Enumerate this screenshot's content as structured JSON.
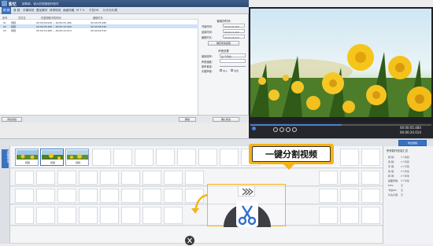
{
  "app": {
    "name": "影忆",
    "subtitle": "超简单、强大的视频制作软件"
  },
  "menu": [
    "视 频",
    "音 频",
    "字幕特效",
    "叠加素材",
    "转场特效",
    "画面风格",
    "M T V",
    "卡拉OK",
    "片头与片尾"
  ],
  "active_menu": "视 频",
  "table": {
    "headers": [
      "序号",
      "文件名",
      "在源视频中的时间",
      "截取时长"
    ],
    "rows": [
      {
        "idx": "01",
        "name": "视频",
        "range": "00:00:00.000 ~ 00:00:05.480",
        "dur": "00:00:05.480"
      },
      {
        "idx": "02",
        "name": "视频",
        "range": "00:00:05.480 ~ 00:00:12.000",
        "dur": "00:00:06.520"
      },
      {
        "idx": "03",
        "name": "视频",
        "range": "00:00:19.480 ~ 00:00:24.014",
        "dur": "00:00:04.534"
      }
    ]
  },
  "props": {
    "cut_section": "截取的时间",
    "start_label": "开始时间:",
    "start_value": "00:00:05.480",
    "end_label": "结束时间:",
    "end_value": "00:00:12.000",
    "dur_label": "截取时长:",
    "dur_value": "00:00:06.520",
    "confirm_cut": "确定修改截取",
    "audio_section": "声音设置",
    "use_audio_label": "使用原声:",
    "use_audio_value": "是(不添加)",
    "audio_speed_label": "声音速度:",
    "volume_label": "原声音量:",
    "fade_label": "头尾声音:",
    "fade_in": "淡入",
    "fade_out": "淡出",
    "apply": "确认修改"
  },
  "table_bottom": {
    "add_video": "添加视频",
    "delete": "删除",
    "ok": "确认修改"
  },
  "preview": {
    "time_current": "00:00:05.480",
    "time_total": "00:00:24.014"
  },
  "timeline": {
    "export_button": "导出视频",
    "clips": [
      {
        "label": "视频"
      },
      {
        "label": "视频"
      },
      {
        "label": "视频"
      }
    ],
    "left_tab": "添加视频片段"
  },
  "info": {
    "title": "所有制作信息汇总",
    "rows": [
      {
        "k": "视  频:",
        "v": "3个视频"
      },
      {
        "k": "音  频:",
        "v": "0个音频"
      },
      {
        "k": "字  幕:",
        "v": "0个字幕"
      },
      {
        "k": "叠  加:",
        "v": "0个叠加"
      },
      {
        "k": "转  场:",
        "v": "0个转场"
      },
      {
        "k": "画面风格:",
        "v": "0个风格"
      },
      {
        "k": "MTV:",
        "v": "无"
      },
      {
        "k": "卡拉OK:",
        "v": "无"
      },
      {
        "k": "片头片尾:",
        "v": "无"
      }
    ]
  },
  "callout": {
    "text": "一键分割视频"
  },
  "colors": {
    "accent": "#f6b315",
    "selection": "#cfe1fb",
    "title_bar": "#2f4b73"
  },
  "icons": {
    "scissors": "scissors-icon",
    "forward": "forward-icon"
  }
}
